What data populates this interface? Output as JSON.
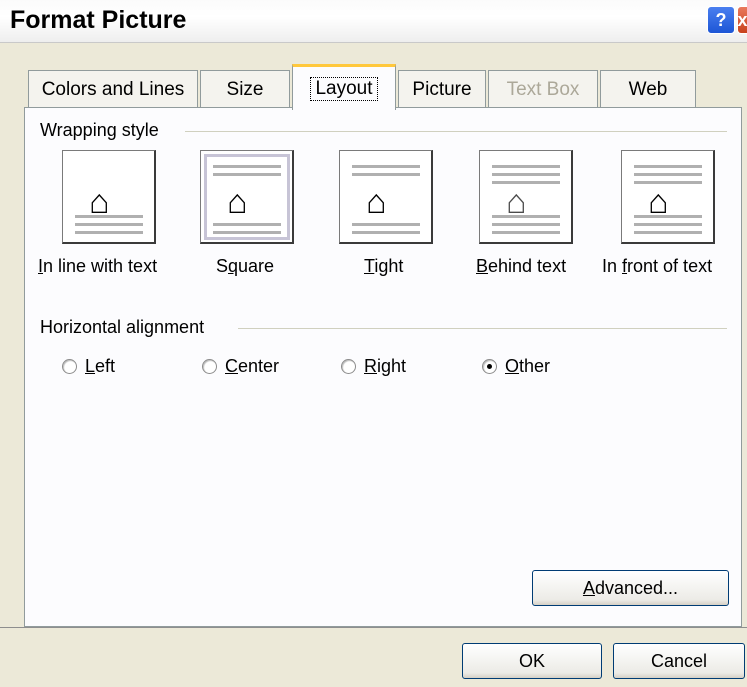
{
  "window": {
    "title": "Format Picture",
    "help_label": "?",
    "close_label": "x"
  },
  "tabs": [
    {
      "label": "Colors and Lines",
      "state": "normal"
    },
    {
      "label": "Size",
      "state": "normal"
    },
    {
      "label": "Layout",
      "state": "active"
    },
    {
      "label": "Picture",
      "state": "normal"
    },
    {
      "label": "Text Box",
      "state": "disabled"
    },
    {
      "label": "Web",
      "state": "normal"
    }
  ],
  "wrapping": {
    "label": "Wrapping style",
    "options": [
      {
        "pre": "",
        "key": "I",
        "post": "n line with text",
        "icon": "dog-inline-icon",
        "selected": false
      },
      {
        "pre": "S",
        "key": "q",
        "post": "uare",
        "icon": "dog-square-icon",
        "selected": true
      },
      {
        "pre": "",
        "key": "T",
        "post": "ight",
        "icon": "dog-tight-icon",
        "selected": false
      },
      {
        "pre": "",
        "key": "B",
        "post": "ehind text",
        "icon": "dog-behind-icon",
        "selected": false
      },
      {
        "pre": "In ",
        "key": "f",
        "post": "ront of text",
        "icon": "dog-front-icon",
        "selected": false
      }
    ]
  },
  "alignment": {
    "label": "Horizontal alignment",
    "options": [
      {
        "key": "L",
        "post": "eft",
        "checked": false
      },
      {
        "key": "C",
        "post": "enter",
        "checked": false
      },
      {
        "key": "R",
        "post": "ight",
        "checked": false
      },
      {
        "key": "O",
        "post": "ther",
        "checked": true
      }
    ]
  },
  "buttons": {
    "advanced_key": "A",
    "advanced_post": "dvanced...",
    "ok": "OK",
    "cancel": "Cancel"
  },
  "colors": {
    "dialog_bg": "#ece9d8",
    "panel_bg": "#fcfcfe",
    "active_tab_accent": "#ffc83c",
    "button_border": "#003c74",
    "close_red": "#c8421d",
    "help_blue": "#1d56d6"
  }
}
